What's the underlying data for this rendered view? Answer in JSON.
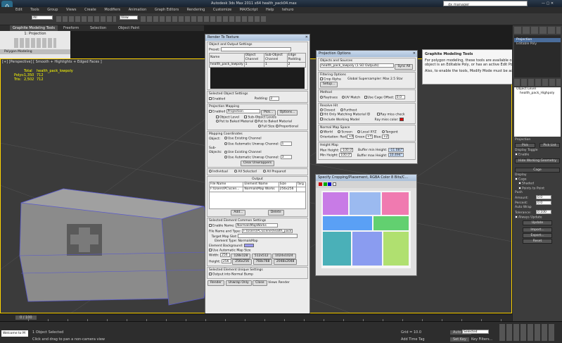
{
  "window": {
    "title": "Autodesk 3ds Max  2011 x64      health_pack04.max",
    "search_placeholder": "dx manager"
  },
  "menu": [
    "Edit",
    "Tools",
    "Group",
    "Views",
    "Create",
    "Modifiers",
    "Animation",
    "Graph Editors",
    "Rendering",
    "Customize",
    "MAXScript",
    "Help",
    "tehuro"
  ],
  "toolbar": {
    "selection_filter": "All",
    "view": "View"
  },
  "ribbon": {
    "tabs": [
      "Graphite Modeling Tools",
      "Freeform",
      "Selection",
      "Object Paint"
    ],
    "sub_label": "1: Projection",
    "section": "Polygon Modeling"
  },
  "viewport": {
    "label": "[+] [Perspective] [ Smooth + Highlights + Edged Faces ]",
    "stats": {
      "total_label": "Total",
      "object": "health_pack_lowpoly",
      "polys_label": "Polys:",
      "polys_total": "1,350",
      "polys_obj": "712",
      "tris_label": "Tris:",
      "tris_total": "2,502",
      "tris_obj": "712"
    }
  },
  "graphite_tip": {
    "title": "Graphite Modeling Tools",
    "body": "For polygon modeling, these tools are available only when the selected object is an Editable Poly, or has an active Edit Poly modifier.",
    "note": "Also, to enable the tools, Modify Mode must be active."
  },
  "render_to_texture": {
    "title": "Render To Texture",
    "object_output": {
      "header": "Object and Output Settings",
      "preset_label": "Preset:",
      "columns": [
        "Name",
        "Object Channel",
        "Sub-Object Channel",
        "Edge Padding"
      ],
      "row": {
        "name": "health_pack_lowpoly",
        "obj": "1",
        "sub": "1",
        "pad": "2"
      }
    },
    "selected_settings": {
      "header": "Selected Object Settings",
      "enabled": "Enabled",
      "padding_label": "Padding:",
      "padding": "2"
    },
    "projection": {
      "header": "Projection Mapping",
      "enabled": "Enabled",
      "projection_value": "Projection",
      "pick": "Pick...",
      "options": "Options...",
      "object_level": "Object Level",
      "sub_object_levels": "Sub-Object Levels",
      "put_baked_obj": "Put to Baked Material",
      "put_baked_sub": "Put to Baked Material",
      "full_size": "Full Size",
      "proportional": "Proportional"
    },
    "mapping": {
      "header": "Mapping Coordinates",
      "object_label": "Object:",
      "use_existing": "Use Existing Channel",
      "use_auto": "Use Automatic Unwrap",
      "channel_label": "Channel:",
      "channel_obj": "1",
      "subobjects_label": "Sub-Objects:",
      "use_existing2": "Use Existing Channel",
      "use_auto2": "Use Automatic Unwrap",
      "channel_sub": "3",
      "clear": "Clear Unwrappers"
    },
    "scope": {
      "individual": "Individual",
      "all_selected": "All Selected",
      "all_prepared": "All Prepared"
    },
    "output": {
      "header": "Output",
      "columns": [
        "File Name",
        "Element Name",
        "Size",
        "Targ"
      ],
      "row": {
        "file": "F:\\Users\\PC\\scen...",
        "element": "NormalsMap Works",
        "size": "256x256",
        "target": ""
      },
      "add": "Add...",
      "delete": "Delete"
    },
    "element": {
      "header": "Selected Element Common Settings",
      "enable": "Enable",
      "name_label": "Name:",
      "name": "NormalsMapWorks",
      "file_label": "File Name and Type:",
      "file": "F:\\Users\\PC\\scene\\health_pack\\nrm\\...",
      "target_label": "Target Map Slot:",
      "element_type_label": "Element Type:",
      "element_type": "NormalsMap",
      "bg_label": "Element Background:",
      "bg_color": "#9b9bff",
      "auto_size": "Use Automatic Map Size",
      "width_label": "Width:",
      "width": "256",
      "height_label": "Height:",
      "height": "256",
      "sizes": [
        "128x128",
        "256x256",
        "512x512",
        "768x768",
        "1024x1024",
        "2048x2048"
      ]
    },
    "unique": {
      "header": "Selected Element Unique Settings",
      "output_bump": "Output into Normal Bump"
    },
    "footer": {
      "render": "Render",
      "unwrap": "Unwrap Only",
      "close": "Close",
      "views_label": "Views",
      "render_label": "Render",
      "original": "Original",
      "baked": "Baked"
    }
  },
  "projection_options": {
    "title": "Projection Options",
    "objects_sources": {
      "header": "Objects and Sources",
      "value": "health_pack_lowpoly (1 SO Outputs)",
      "sync": "Sync All"
    },
    "filtering": {
      "header": "Filtering Options",
      "crop_alpha": "Crop Alpha",
      "global": "Global Supersampler: Max 2.5 Star",
      "setup": "Setup..."
    },
    "method": {
      "header": "Method",
      "raytrace": "Raytrace",
      "uv_match": "UV Match",
      "use_cage": "Use Cage",
      "offset_label": "Offset:",
      "offset": "0.0"
    },
    "resolve": {
      "header": "Resolve Hit",
      "closest": "Closest",
      "furthest": "Furthest",
      "hit_only": "Hit Only Matching Material ID",
      "ray_miss_check": "Ray miss check",
      "include_working": "Include Working Model",
      "ray_miss_color": "Ray miss color:",
      "miss_color": "#e00000"
    },
    "normal_space": {
      "header": "Normal Map Space",
      "world": "World",
      "screen": "Screen",
      "local_xyz": "Local XYZ",
      "tangent": "Tangent",
      "orientation_label": "Orientation:",
      "red_label": "Red:",
      "red": "+X",
      "green_label": "Green:",
      "green": "+Y",
      "blue_label": "Blue:",
      "blue": "+Z"
    },
    "height": {
      "header": "Height Map",
      "max_height_label": "Max Height:",
      "max_height": "-100.0\"",
      "min_height_label": "Min Height:",
      "min_height": "100.0\"",
      "buf_min_label": "Buffer min Height:",
      "buf_min": "-11.087\"",
      "buf_max_label": "Buffer max Height:",
      "buf_max": "10.494\""
    }
  },
  "crop_window": {
    "title": "Specify Cropping/Placement, RGBA Color 8 Bits/C..."
  },
  "right_panel": {
    "modifier_list_label": "Modifier List",
    "stack": [
      "Projection",
      "Editable Poly"
    ],
    "objects_header": "Object Level",
    "object_item": "health_pack_Highpoly",
    "projection_label": "Projection",
    "pick": "Pick",
    "pick_list": "Pick List",
    "display_toggle": "Display Toggle",
    "enable": "Enable",
    "hide_working": "Hide Working Geometry",
    "cage_header": "Cage",
    "display_label": "Display",
    "cage": "Cage",
    "shaded": "Shaded",
    "points_to_point": "Points to Point",
    "push_label": "Push",
    "amount_label": "Amount:",
    "amount": "0.0",
    "percent_label": "Percent:",
    "percent": "0.0",
    "auto_wrap": "Auto Wrap",
    "tolerance_label": "Tolerance:",
    "tolerance": "0.100",
    "always_update": "Always Update",
    "update": "Update",
    "import": "Import...",
    "export": "Export...",
    "reset": "Reset"
  },
  "timeline": {
    "frame": "0 / 100"
  },
  "status": {
    "selected": "1 Object Selected",
    "prompt": "Click and drag to pan a non-camera view",
    "maxscript": "Welcome to M",
    "grid": "Grid = 10.0",
    "autokey": "Auto Key",
    "autokey_value": "Selected",
    "setkey": "Set Key",
    "key_filters": "Key Filters...",
    "add_time_tag": "Add Time Tag"
  }
}
